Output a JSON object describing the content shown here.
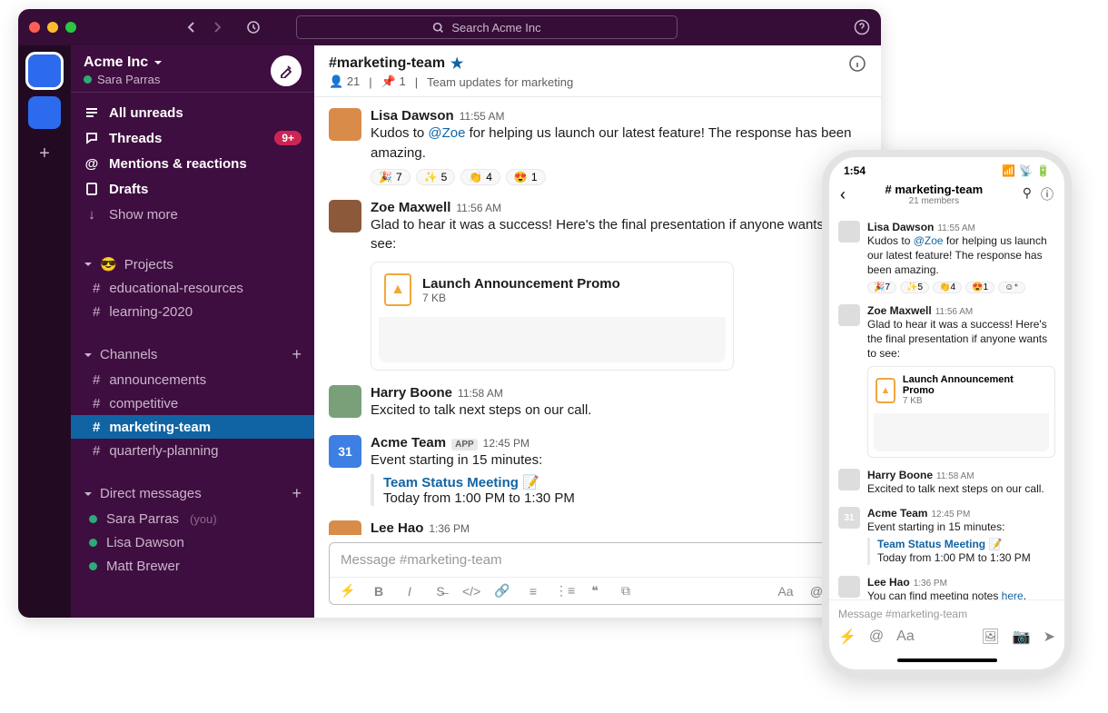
{
  "titlebar": {
    "search_placeholder": "Search Acme Inc"
  },
  "workspace": {
    "name": "Acme Inc",
    "user": "Sara Parras"
  },
  "sidebar": {
    "nav": {
      "unreads": "All unreads",
      "threads": "Threads",
      "threads_badge": "9+",
      "mentions": "Mentions & reactions",
      "drafts": "Drafts",
      "show_more": "Show more"
    },
    "sections": {
      "projects": {
        "label": "Projects",
        "emoji": "😎",
        "items": [
          "educational-resources",
          "learning-2020"
        ]
      },
      "channels": {
        "label": "Channels",
        "items": [
          "announcements",
          "competitive",
          "marketing-team",
          "quarterly-planning"
        ],
        "active": "marketing-team"
      },
      "dms": {
        "label": "Direct messages",
        "items": [
          {
            "name": "Sara Parras",
            "you": true
          },
          {
            "name": "Lisa Dawson",
            "you": false
          },
          {
            "name": "Matt Brewer",
            "you": false
          }
        ]
      }
    }
  },
  "channel": {
    "name": "#marketing-team",
    "members": "21",
    "pins": "1",
    "topic": "Team updates for marketing"
  },
  "messages": [
    {
      "id": "m1",
      "author": "Lisa Dawson",
      "time": "11:55 AM",
      "avatar": "lisa",
      "text_pre": "Kudos to ",
      "mention": "@Zoe",
      "text_post": " for helping us launch our latest feature! The response has been amazing.",
      "reactions": [
        {
          "e": "🎉",
          "c": "7"
        },
        {
          "e": "✨",
          "c": "5"
        },
        {
          "e": "👏",
          "c": "4"
        },
        {
          "e": "😍",
          "c": "1"
        }
      ]
    },
    {
      "id": "m2",
      "author": "Zoe Maxwell",
      "time": "11:56 AM",
      "avatar": "zoe",
      "text": "Glad to hear it was a success! Here's the final presentation if anyone wants to see:",
      "attachment": {
        "title": "Launch Announcement Promo",
        "meta": "7 KB"
      }
    },
    {
      "id": "m3",
      "author": "Harry Boone",
      "time": "11:58 AM",
      "avatar": "harry",
      "text": "Excited to talk next steps on our call."
    },
    {
      "id": "m4",
      "author": "Acme Team",
      "time": "12:45 PM",
      "avatar": "cal",
      "app": true,
      "app_label": "APP",
      "text": "Event starting in 15 minutes:",
      "event": {
        "title": "Team Status Meeting",
        "emoji": "📝",
        "time": "Today from 1:00 PM to 1:30 PM"
      }
    },
    {
      "id": "m5",
      "author": "Lee Hao",
      "time": "1:36 PM",
      "avatar": "lee",
      "text_pre": "You can find meeting notes ",
      "link": "here",
      "text_post": "."
    }
  ],
  "composer": {
    "placeholder": "Message #marketing-team"
  },
  "mobile": {
    "clock": "1:54",
    "title": "# marketing-team",
    "members": "21 members",
    "composer_placeholder": "Message #marketing-team"
  }
}
